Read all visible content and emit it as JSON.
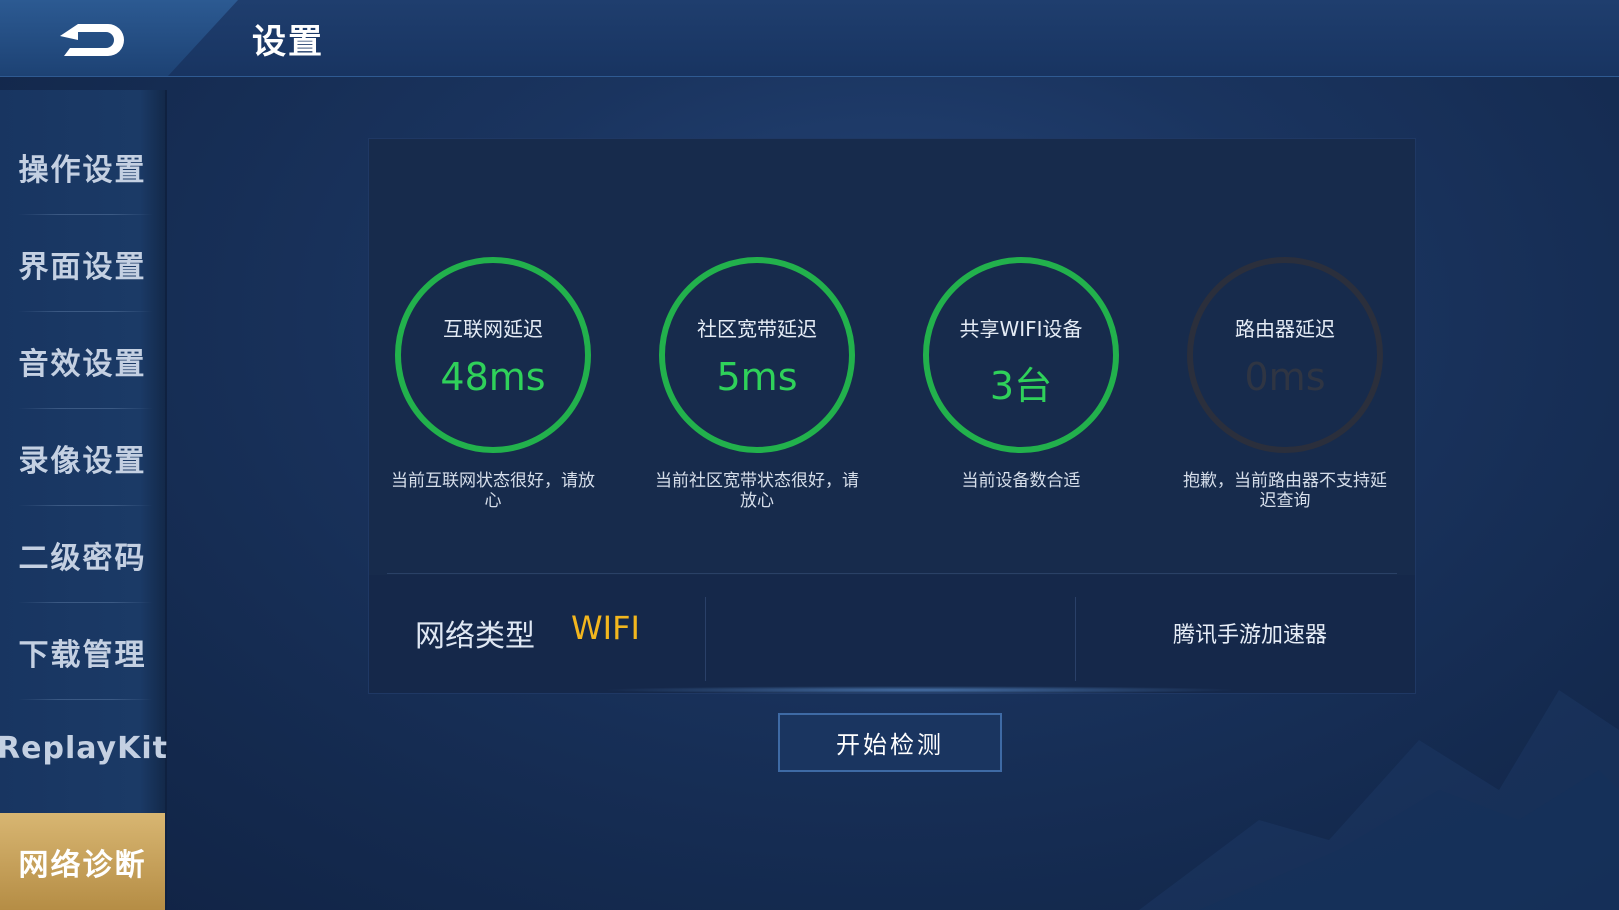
{
  "header": {
    "title": "设置",
    "back_icon": "back-arrow-icon"
  },
  "sidebar": {
    "items": [
      {
        "label": "操作设置"
      },
      {
        "label": "界面设置"
      },
      {
        "label": "音效设置"
      },
      {
        "label": "录像设置"
      },
      {
        "label": "二级密码"
      },
      {
        "label": "下载管理"
      },
      {
        "label": "ReplayKit"
      },
      {
        "label": "网络诊断",
        "active": true
      }
    ]
  },
  "metrics": [
    {
      "label": "互联网延迟",
      "value": "48ms",
      "desc": "当前互联网状态很好，请放心",
      "status": "good"
    },
    {
      "label": "社区宽带延迟",
      "value": "5ms",
      "desc": "当前社区宽带状态很好，请放心",
      "status": "good"
    },
    {
      "label": "共享WIFI设备",
      "value": "3台",
      "desc": "当前设备数合适",
      "status": "good"
    },
    {
      "label": "路由器延迟",
      "value": "0ms",
      "desc": "抱歉，当前路由器不支持延迟查询",
      "status": "unsupported"
    }
  ],
  "network": {
    "type_label": "网络类型",
    "type_value": "WIFI"
  },
  "accelerator_label": "腾讯手游加速器",
  "start_button_label": "开始检测",
  "colors": {
    "good": "#22b14c",
    "value_good": "#2fd15a",
    "unsupported": "#2b2f3c",
    "network_value": "#f2b61e",
    "active_tab": "#c9a35a"
  }
}
